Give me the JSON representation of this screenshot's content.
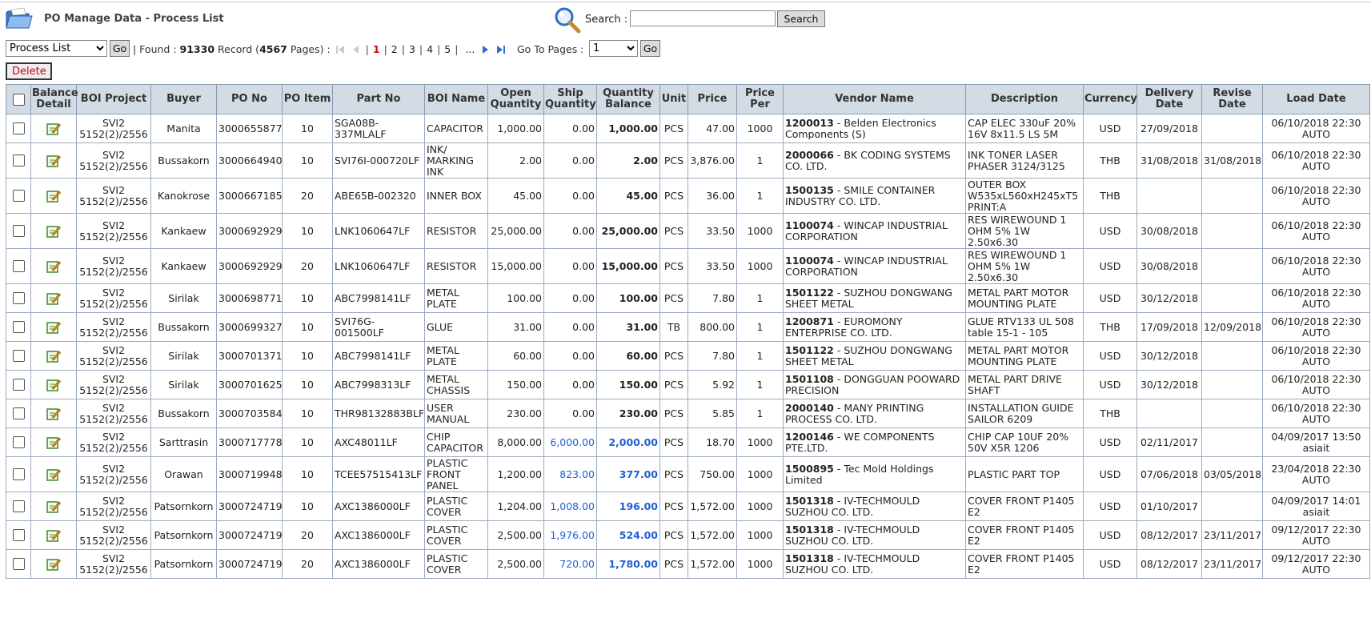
{
  "header": {
    "title": "PO Manage Data - Process List",
    "search_label": "Search :",
    "search_value": "",
    "search_button": "Search"
  },
  "toolbar": {
    "view_selected": "Process List",
    "go_label": "Go",
    "found_prefix": "| Found :",
    "found_count": "91330",
    "record_word": "Record (",
    "page_count": "4567",
    "pages_suffix": "Pages) :",
    "pages": [
      "1",
      "2",
      "3",
      "4",
      "5"
    ],
    "current_page": "1",
    "ellipsis": "...",
    "goto_label": "Go To Pages :",
    "goto_selected": "1",
    "go2_label": "Go",
    "delete_label": "Delete"
  },
  "columns": [
    "Balance Detail",
    "BOI Project",
    "Buyer",
    "PO No",
    "PO Item",
    "Part No",
    "BOI Name",
    "Open Quantity",
    "Ship Quantity",
    "Quantity Balance",
    "Unit",
    "Price",
    "Price Per",
    "Vendor Name",
    "Description",
    "Currency",
    "Delivery Date",
    "Revise Date",
    "Load Date"
  ],
  "rows": [
    {
      "boi": "SVI2 5152(2)/2556",
      "buyer": "Manita",
      "po": "3000655877",
      "item": "10",
      "part": "SGA08B-337MLALF",
      "boiname": "CAPACITOR",
      "open": "1,000.00",
      "ship": "0.00",
      "bal": "1,000.00",
      "unit": "PCS",
      "price": "47.00",
      "per": "1000",
      "vcode": "1200013",
      "vname": " - Belden Electronics Components (S)",
      "desc": "CAP ELEC 330uF 20% 16V 8x11.5 LS 5M",
      "cur": "USD",
      "deliv": "27/09/2018",
      "revise": "",
      "load": "06/10/2018 22:30 AUTO",
      "blue": false,
      "tall": false
    },
    {
      "boi": "SVI2 5152(2)/2556",
      "buyer": "Bussakorn",
      "po": "3000664940",
      "item": "10",
      "part": "SVI76I-000720LF",
      "boiname": "INK/ MARKING INK",
      "open": "2.00",
      "ship": "0.00",
      "bal": "2.00",
      "unit": "PCS",
      "price": "3,876.00",
      "per": "1",
      "vcode": "2000066",
      "vname": " - BK CODING SYSTEMS CO. LTD.",
      "desc": "INK TONER LASER PHASER 3124/3125",
      "cur": "THB",
      "deliv": "31/08/2018",
      "revise": "31/08/2018",
      "load": "06/10/2018 22:30 AUTO",
      "blue": false,
      "tall": true
    },
    {
      "boi": "SVI2 5152(2)/2556",
      "buyer": "Kanokrose",
      "po": "3000667185",
      "item": "20",
      "part": "ABE65B-002320",
      "boiname": "INNER BOX",
      "open": "45.00",
      "ship": "0.00",
      "bal": "45.00",
      "unit": "PCS",
      "price": "36.00",
      "per": "1",
      "vcode": "1500135",
      "vname": " - SMILE CONTAINER INDUSTRY CO. LTD.",
      "desc": "OUTER BOX W535xL560xH245xT5 PRINT:A",
      "cur": "THB",
      "deliv": "",
      "revise": "",
      "load": "06/10/2018 22:30 AUTO",
      "blue": false,
      "tall": true
    },
    {
      "boi": "SVI2 5152(2)/2556",
      "buyer": "Kankaew",
      "po": "3000692929",
      "item": "10",
      "part": "LNK1060647LF",
      "boiname": "RESISTOR",
      "open": "25,000.00",
      "ship": "0.00",
      "bal": "25,000.00",
      "unit": "PCS",
      "price": "33.50",
      "per": "1000",
      "vcode": "1100074",
      "vname": " - WINCAP INDUSTRIAL CORPORATION",
      "desc": "RES WIREWOUND 1 OHM 5% 1W 2.50x6.30",
      "cur": "USD",
      "deliv": "30/08/2018",
      "revise": "",
      "load": "06/10/2018 22:30 AUTO",
      "blue": false,
      "tall": true
    },
    {
      "boi": "SVI2 5152(2)/2556",
      "buyer": "Kankaew",
      "po": "3000692929",
      "item": "20",
      "part": "LNK1060647LF",
      "boiname": "RESISTOR",
      "open": "15,000.00",
      "ship": "0.00",
      "bal": "15,000.00",
      "unit": "PCS",
      "price": "33.50",
      "per": "1000",
      "vcode": "1100074",
      "vname": " - WINCAP INDUSTRIAL CORPORATION",
      "desc": "RES WIREWOUND 1 OHM 5% 1W 2.50x6.30",
      "cur": "USD",
      "deliv": "30/08/2018",
      "revise": "",
      "load": "06/10/2018 22:30 AUTO",
      "blue": false,
      "tall": true
    },
    {
      "boi": "SVI2 5152(2)/2556",
      "buyer": "Sirilak",
      "po": "3000698771",
      "item": "10",
      "part": "ABC7998141LF",
      "boiname": "METAL PLATE",
      "open": "100.00",
      "ship": "0.00",
      "bal": "100.00",
      "unit": "PCS",
      "price": "7.80",
      "per": "1",
      "vcode": "1501122",
      "vname": " - SUZHOU DONGWANG SHEET METAL",
      "desc": "METAL PART MOTOR MOUNTING PLATE",
      "cur": "USD",
      "deliv": "30/12/2018",
      "revise": "",
      "load": "06/10/2018 22:30 AUTO",
      "blue": false,
      "tall": false
    },
    {
      "boi": "SVI2 5152(2)/2556",
      "buyer": "Bussakorn",
      "po": "3000699327",
      "item": "10",
      "part": "SVI76G-001500LF",
      "boiname": "GLUE",
      "open": "31.00",
      "ship": "0.00",
      "bal": "31.00",
      "unit": "TB",
      "price": "800.00",
      "per": "1",
      "vcode": "1200871",
      "vname": " - EUROMONY ENTERPRISE CO. LTD.",
      "desc": "GLUE RTV133 UL 508 table 15-1 - 105",
      "cur": "THB",
      "deliv": "17/09/2018",
      "revise": "12/09/2018",
      "load": "06/10/2018 22:30 AUTO",
      "blue": false,
      "tall": false
    },
    {
      "boi": "SVI2 5152(2)/2556",
      "buyer": "Sirilak",
      "po": "3000701371",
      "item": "10",
      "part": "ABC7998141LF",
      "boiname": "METAL PLATE",
      "open": "60.00",
      "ship": "0.00",
      "bal": "60.00",
      "unit": "PCS",
      "price": "7.80",
      "per": "1",
      "vcode": "1501122",
      "vname": " - SUZHOU DONGWANG SHEET METAL",
      "desc": "METAL PART MOTOR MOUNTING PLATE",
      "cur": "USD",
      "deliv": "30/12/2018",
      "revise": "",
      "load": "06/10/2018 22:30 AUTO",
      "blue": false,
      "tall": false
    },
    {
      "boi": "SVI2 5152(2)/2556",
      "buyer": "Sirilak",
      "po": "3000701625",
      "item": "10",
      "part": "ABC7998313LF",
      "boiname": "METAL CHASSIS",
      "open": "150.00",
      "ship": "0.00",
      "bal": "150.00",
      "unit": "PCS",
      "price": "5.92",
      "per": "1",
      "vcode": "1501108",
      "vname": " - DONGGUAN POOWARD PRECISION",
      "desc": "METAL PART DRIVE SHAFT",
      "cur": "USD",
      "deliv": "30/12/2018",
      "revise": "",
      "load": "06/10/2018 22:30 AUTO",
      "blue": false,
      "tall": false
    },
    {
      "boi": "SVI2 5152(2)/2556",
      "buyer": "Bussakorn",
      "po": "3000703584",
      "item": "10",
      "part": "THR98132883BLF",
      "boiname": "USER MANUAL",
      "open": "230.00",
      "ship": "0.00",
      "bal": "230.00",
      "unit": "PCS",
      "price": "5.85",
      "per": "1",
      "vcode": "2000140",
      "vname": " - MANY PRINTING PROCESS CO. LTD.",
      "desc": "INSTALLATION GUIDE SAILOR 6209",
      "cur": "THB",
      "deliv": "",
      "revise": "",
      "load": "06/10/2018 22:30 AUTO",
      "blue": false,
      "tall": false
    },
    {
      "boi": "SVI2 5152(2)/2556",
      "buyer": "Sarttrasin",
      "po": "3000717778",
      "item": "10",
      "part": "AXC48011LF",
      "boiname": "CHIP CAPACITOR",
      "open": "8,000.00",
      "ship": "6,000.00",
      "bal": "2,000.00",
      "unit": "PCS",
      "price": "18.70",
      "per": "1000",
      "vcode": "1200146",
      "vname": " - WE COMPONENTS PTE.LTD.",
      "desc": "CHIP CAP 10UF 20% 50V X5R 1206",
      "cur": "USD",
      "deliv": "02/11/2017",
      "revise": "",
      "load": "04/09/2017 13:50 asiait",
      "blue": true,
      "tall": false
    },
    {
      "boi": "SVI2 5152(2)/2556",
      "buyer": "Orawan",
      "po": "3000719948",
      "item": "10",
      "part": "TCEE57515413LF",
      "boiname": "PLASTIC FRONT PANEL",
      "open": "1,200.00",
      "ship": "823.00",
      "bal": "377.00",
      "unit": "PCS",
      "price": "750.00",
      "per": "1000",
      "vcode": "1500895",
      "vname": " - Tec Mold Holdings Limited",
      "desc": "PLASTIC PART TOP",
      "cur": "USD",
      "deliv": "07/06/2018",
      "revise": "03/05/2018",
      "load": "23/04/2018 22:30 AUTO",
      "blue": true,
      "tall": true
    },
    {
      "boi": "SVI2 5152(2)/2556",
      "buyer": "Patsornkorn",
      "po": "3000724719",
      "item": "10",
      "part": "AXC1386000LF",
      "boiname": "PLASTIC COVER",
      "open": "1,204.00",
      "ship": "1,008.00",
      "bal": "196.00",
      "unit": "PCS",
      "price": "1,572.00",
      "per": "1000",
      "vcode": "1501318",
      "vname": " - IV-TECHMOULD SUZHOU CO. LTD.",
      "desc": "COVER FRONT P1405 E2",
      "cur": "USD",
      "deliv": "01/10/2017",
      "revise": "",
      "load": "04/09/2017 14:01 asiait",
      "blue": true,
      "tall": false
    },
    {
      "boi": "SVI2 5152(2)/2556",
      "buyer": "Patsornkorn",
      "po": "3000724719",
      "item": "20",
      "part": "AXC1386000LF",
      "boiname": "PLASTIC COVER",
      "open": "2,500.00",
      "ship": "1,976.00",
      "bal": "524.00",
      "unit": "PCS",
      "price": "1,572.00",
      "per": "1000",
      "vcode": "1501318",
      "vname": " - IV-TECHMOULD SUZHOU CO. LTD.",
      "desc": "COVER FRONT P1405 E2",
      "cur": "USD",
      "deliv": "08/12/2017",
      "revise": "23/11/2017",
      "load": "09/12/2017 22:30 AUTO",
      "blue": true,
      "tall": false
    },
    {
      "boi": "SVI2 5152(2)/2556",
      "buyer": "Patsornkorn",
      "po": "3000724719",
      "item": "20",
      "part": "AXC1386000LF",
      "boiname": "PLASTIC COVER",
      "open": "2,500.00",
      "ship": "720.00",
      "bal": "1,780.00",
      "unit": "PCS",
      "price": "1,572.00",
      "per": "1000",
      "vcode": "1501318",
      "vname": " - IV-TECHMOULD SUZHOU CO. LTD.",
      "desc": "COVER FRONT P1405 E2",
      "cur": "USD",
      "deliv": "08/12/2017",
      "revise": "23/11/2017",
      "load": "09/12/2017 22:30 AUTO",
      "blue": true,
      "tall": false
    }
  ]
}
